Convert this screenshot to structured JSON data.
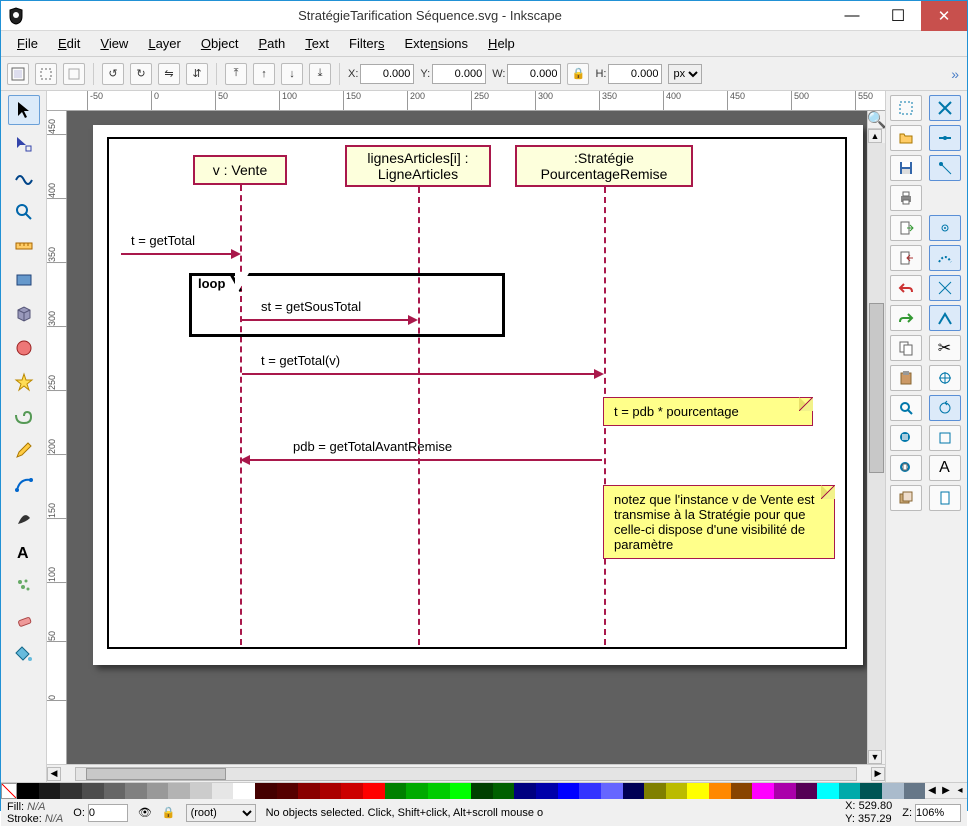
{
  "window": {
    "title": "StratégieTarification Séquence.svg - Inkscape"
  },
  "menubar": [
    "File",
    "Edit",
    "View",
    "Layer",
    "Object",
    "Path",
    "Text",
    "Filters",
    "Extensions",
    "Help"
  ],
  "toolbar": {
    "x_label": "X:",
    "x": "0.000",
    "y_label": "Y:",
    "y": "0.000",
    "w_label": "W:",
    "w": "0.000",
    "h_label": "H:",
    "h": "0.000",
    "unit": "px"
  },
  "hruler": [
    -50,
    0,
    50,
    100,
    150,
    200,
    250,
    300,
    350,
    400,
    450,
    500,
    550
  ],
  "vruler": [
    450,
    400,
    350,
    300,
    250,
    200,
    150,
    100,
    50,
    0
  ],
  "diagram": {
    "obj1": "v : Vente",
    "obj2_l1": "lignesArticles[i] :",
    "obj2_l2": "LigneArticles",
    "obj3_l1": ":Stratégie",
    "obj3_l2": "PourcentageRemise",
    "msg1": "t = getTotal",
    "loop": "loop",
    "msg2": "st = getSousTotal",
    "msg3": "t = getTotal(v)",
    "note1": "t = pdb * pourcentage",
    "msg4": "pdb = getTotalAvantRemise",
    "note2": "notez que l'instance v de Vente est transmise à la Stratégie pour que celle-ci dispose d'une visibilité de paramètre"
  },
  "status": {
    "fill": "Fill:",
    "fillv": "N/A",
    "stroke": "Stroke:",
    "strokev": "N/A",
    "o": "O:",
    "ov": "0",
    "layer": "(root)",
    "hint": "No objects selected. Click, Shift+click, Alt+scroll mouse o",
    "xl": "X:",
    "xv": "529.80",
    "yl": "Y:",
    "yv": "357.29",
    "zl": "Z:",
    "zv": "106%"
  },
  "palette": [
    "#000000",
    "#1a1a1a",
    "#333333",
    "#4d4d4d",
    "#666666",
    "#808080",
    "#999999",
    "#b3b3b3",
    "#cccccc",
    "#e6e6e6",
    "#ffffff",
    "#440000",
    "#550000",
    "#880000",
    "#aa0000",
    "#cc0000",
    "#ff0000",
    "#008000",
    "#00aa00",
    "#00cc00",
    "#00ff00",
    "#004000",
    "#006000",
    "#000080",
    "#0000aa",
    "#0000ff",
    "#3333ff",
    "#6666ff",
    "#000055",
    "#808000",
    "#bbbb00",
    "#ffff00",
    "#ff8800",
    "#884400",
    "#ff00ff",
    "#aa00aa",
    "#550055",
    "#00ffff",
    "#00aaaa",
    "#005555",
    "#abc",
    "#678"
  ]
}
